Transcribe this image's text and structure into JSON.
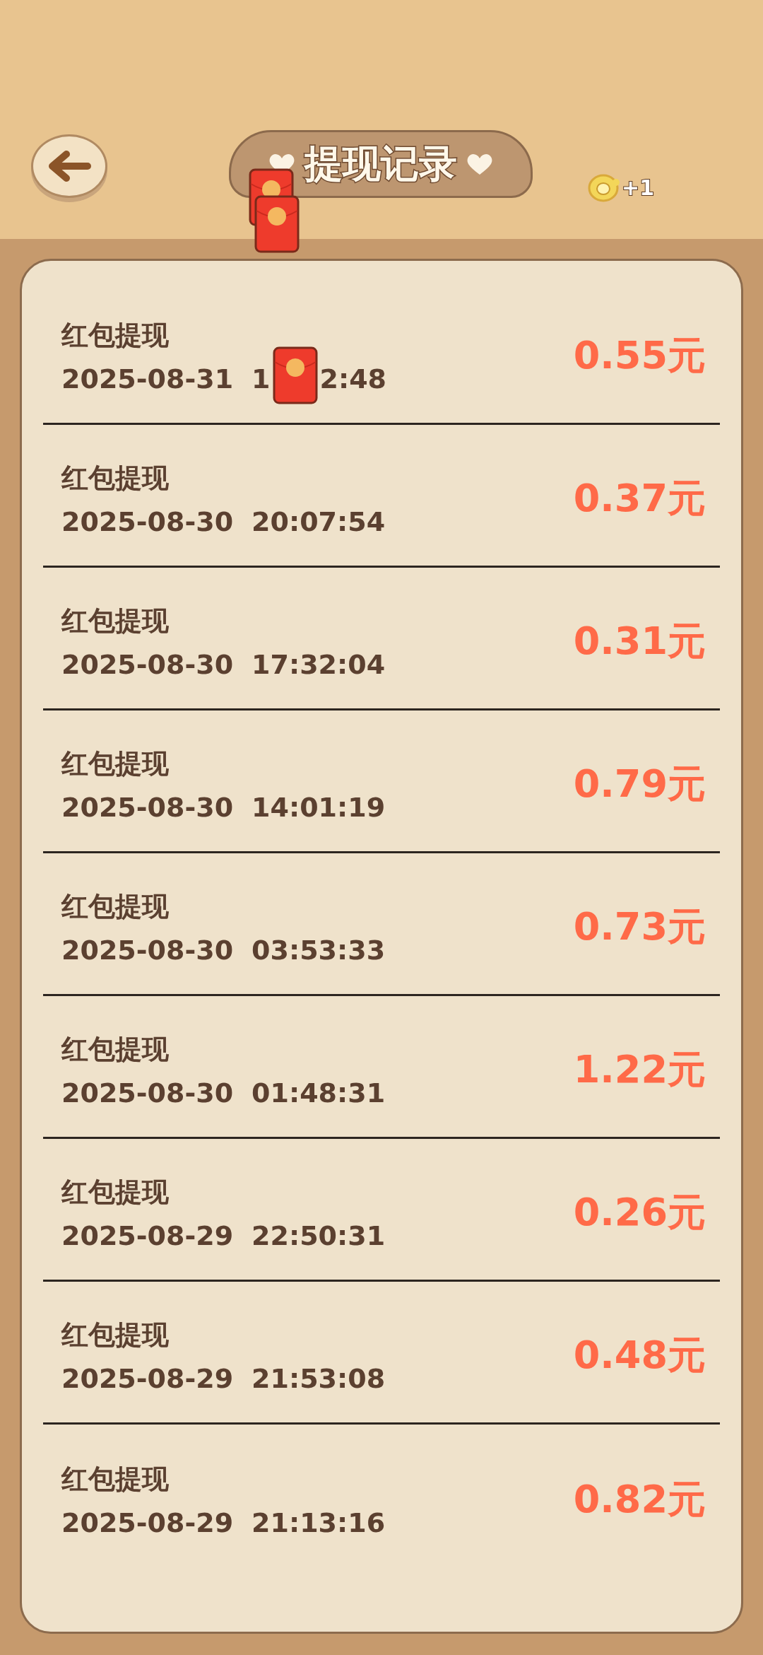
{
  "header": {
    "title": "提现记录",
    "reward": "+1"
  },
  "records": [
    {
      "title": "红包提现",
      "date": "2025-08-31",
      "time": [
        "1",
        "2:48"
      ],
      "amount": "0.55元"
    },
    {
      "title": "红包提现",
      "date": "2025-08-30",
      "time": [
        "20:07:54"
      ],
      "amount": "0.37元"
    },
    {
      "title": "红包提现",
      "date": "2025-08-30",
      "time": [
        "17:32:04"
      ],
      "amount": "0.31元"
    },
    {
      "title": "红包提现",
      "date": "2025-08-30",
      "time": [
        "14:01:19"
      ],
      "amount": "0.79元"
    },
    {
      "title": "红包提现",
      "date": "2025-08-30",
      "time": [
        "03:53:33"
      ],
      "amount": "0.73元"
    },
    {
      "title": "红包提现",
      "date": "2025-08-30",
      "time": [
        "01:48:31"
      ],
      "amount": "1.22元"
    },
    {
      "title": "红包提现",
      "date": "2025-08-29",
      "time": [
        "22:50:31"
      ],
      "amount": "0.26元"
    },
    {
      "title": "红包提现",
      "date": "2025-08-29",
      "time": [
        "21:53:08"
      ],
      "amount": "0.48元"
    },
    {
      "title": "红包提现",
      "date": "2025-08-29",
      "time": [
        "21:13:16"
      ],
      "amount": "0.82元"
    }
  ]
}
